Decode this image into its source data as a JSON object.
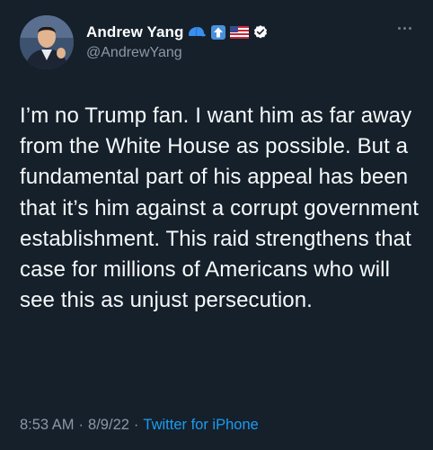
{
  "tweet": {
    "display_name": "Andrew Yang",
    "handle": "@AndrewYang",
    "text": "I’m no Trump fan. I want him as far away from the White House as possible. But a fundamental part of his appeal has been that it’s him against a corrupt government establishment. This raid strengthens that case for millions of Americans who will see this as unjust persecution.",
    "time": "8:53 AM",
    "date": "8/9/22",
    "separator": "·",
    "source": "Twitter for iPhone"
  },
  "icons": {
    "name_badges": [
      "blue-cap-emoji-icon",
      "up-arrow-emoji-icon",
      "us-flag-emoji-icon",
      "verified-badge-icon"
    ],
    "more": "more-options-icon"
  },
  "colors": {
    "background": "#15202b",
    "text": "#f7f9f9",
    "secondary": "#8b98a5",
    "link": "#1d9bf0"
  }
}
